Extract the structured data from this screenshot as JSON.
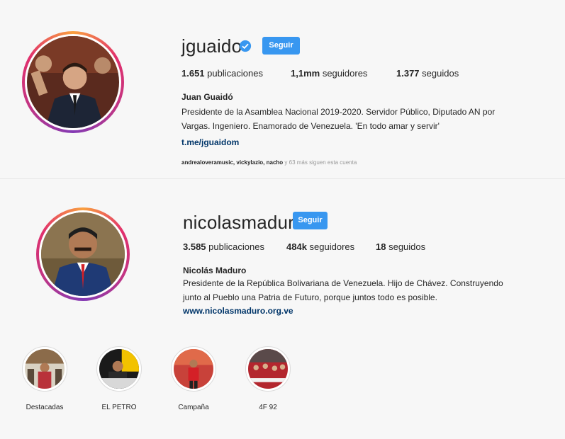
{
  "profiles": [
    {
      "username": "jguaido",
      "verified": true,
      "follow_label": "Seguir",
      "stats": [
        {
          "value": "1.651",
          "label": "publicaciones"
        },
        {
          "value": "1,1mm",
          "label": "seguidores"
        },
        {
          "value": "1.377",
          "label": "seguidos"
        }
      ],
      "full_name": "Juan Guaidó",
      "bio_line1": "Presidente de la Asamblea Nacional 2019-2020. Servidor Público, Diputado AN por",
      "bio_line2": "Vargas. Ingeniero. Enamorado de Venezuela. 'En todo amar y servir'",
      "link": "t.me/jguaidom",
      "followed_by_names": "andrealoveramusic, vickylazio, nacho",
      "followed_by_rest": "y 63 más siguen esta cuenta"
    },
    {
      "username": "nicolasmaduro",
      "verified": false,
      "follow_label": "Seguir",
      "stats": [
        {
          "value": "3.585",
          "label": "publicaciones"
        },
        {
          "value": "484k",
          "label": "seguidores"
        },
        {
          "value": "18",
          "label": "seguidos"
        }
      ],
      "full_name": "Nicolás Maduro",
      "bio_line1": "Presidente de la República Bolivariana de Venezuela. Hijo de Chávez. Construyendo",
      "bio_line2": "junto al Pueblo una Patria de Futuro, porque juntos todo es posible.",
      "link": "www.nicolasmaduro.org.ve",
      "highlights": [
        {
          "label": "Destacadas"
        },
        {
          "label": "EL PETRO"
        },
        {
          "label": "Campaña"
        },
        {
          "label": "4F 92"
        }
      ]
    }
  ],
  "colors": {
    "accent": "#3897f0",
    "link": "#003569",
    "background": "#f7f7f7"
  }
}
